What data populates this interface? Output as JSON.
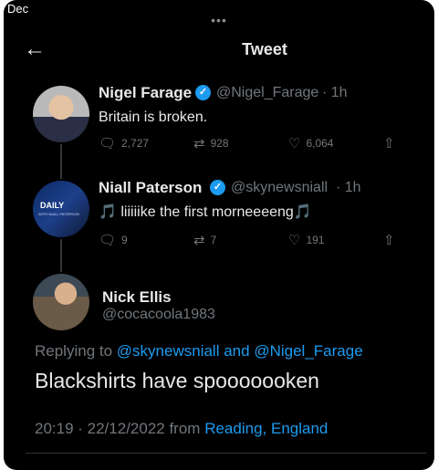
{
  "corner_label": "Dec",
  "header": {
    "title": "Tweet"
  },
  "tweets": [
    {
      "name": "Nigel Farage",
      "handle": "@Nigel_Farage",
      "time": "· 1h",
      "text": "Britain is broken.",
      "replies": "2,727",
      "retweets": "928",
      "likes": "6,064"
    },
    {
      "name": "Niall Paterson",
      "handle": "@skynewsniall",
      "time": "· 1h",
      "text": "🎵 liiiiike the first morneeeeng🎵",
      "replies": "9",
      "retweets": "7",
      "likes": "191",
      "avatar_text": "DAILY",
      "avatar_subtext": "WITH NIALL PATERSON"
    }
  ],
  "main_tweet": {
    "name": "Nick Ellis",
    "handle": "@cocacoola1983",
    "replying_prefix": "Replying to",
    "reply_user1": "@skynewsniall",
    "reply_and": "and",
    "reply_user2": "@Nigel_Farage",
    "text": "Blackshirts have spooooooken",
    "timestamp": "20:19 · 22/12/2022 from",
    "location": "Reading, England"
  },
  "icons": {
    "back": "arrow-left-icon",
    "reply": "reply-icon",
    "retweet": "retweet-icon",
    "like": "heart-icon",
    "share": "share-icon",
    "verified": "verified-badge-icon"
  },
  "colors": {
    "background": "#000000",
    "accent": "#1d9bf0",
    "muted": "#71767b",
    "text": "#e7e9ea"
  }
}
